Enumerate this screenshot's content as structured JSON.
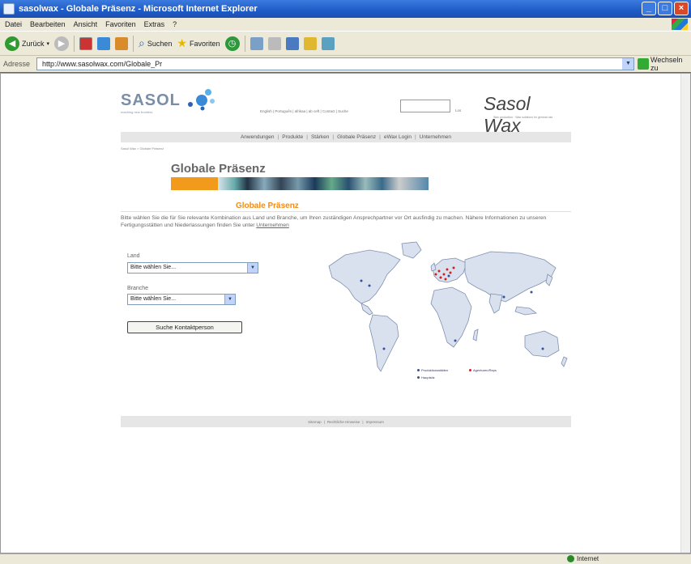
{
  "window": {
    "title": "sasolwax - Globale Präsenz - Microsoft Internet Explorer"
  },
  "menu": [
    "Datei",
    "Bearbeiten",
    "Ansicht",
    "Favoriten",
    "Extras",
    "?"
  ],
  "toolbar": {
    "back_label": "Zurück",
    "search_label": "Suchen",
    "favorites_label": "Favoriten"
  },
  "address": {
    "label": "Adresse",
    "url": "http://www.sasolwax.com/Globale_Pr",
    "go_label": "Wechseln zu"
  },
  "status": {
    "zone_label": "Internet"
  },
  "site": {
    "logo_word": "SASOL",
    "logo_tagline": "reaching new frontiers",
    "top_links": "English | Português | afrikaa | ab ceft | Contact | Suche",
    "search_go": "Los",
    "brand": "Sasol Wax",
    "brand_tagline": "Wax production · Wax solutions for general use",
    "main_nav": [
      "Anwendungen",
      "Produkte",
      "Stärken",
      "Globale Präsenz",
      "eWax Login",
      "Unternehmen"
    ],
    "breadcrumb": "Sasol Wax > Globale Präsenz",
    "page_title": "Globale Präsenz",
    "subtitle": "Globale Präsenz",
    "intro_text": "Bitte wählen Sie die für Sie relevante Kombination aus Land und Branche, um Ihren zuständigen Ansprechpartner vor Ort ausfindig zu machen. Nähere Informationen zu unseren Fertigungsstätten und Niederlassungen finden Sie unter ",
    "intro_link": "Unternehmen",
    "land_label": "Land",
    "land_value": "Bitte wählen Sie...",
    "branche_label": "Branche",
    "branche_value": "Bitte wählen Sie...",
    "search_button": "Suche Kontaktperson",
    "legend": {
      "production": "Produktionsstätten",
      "agencies": "Agenturen/Reps",
      "headquarters": "Hauptsitz"
    },
    "footer_links": [
      "Sitemap",
      "Rechtliche Hinweise",
      "Impressum"
    ]
  },
  "colors": {
    "accent_orange": "#f08c1a",
    "map_land": "#d9e1ee",
    "map_outline": "#8090b0",
    "legend_blue": "#3a4f9a",
    "legend_red": "#d22020"
  }
}
